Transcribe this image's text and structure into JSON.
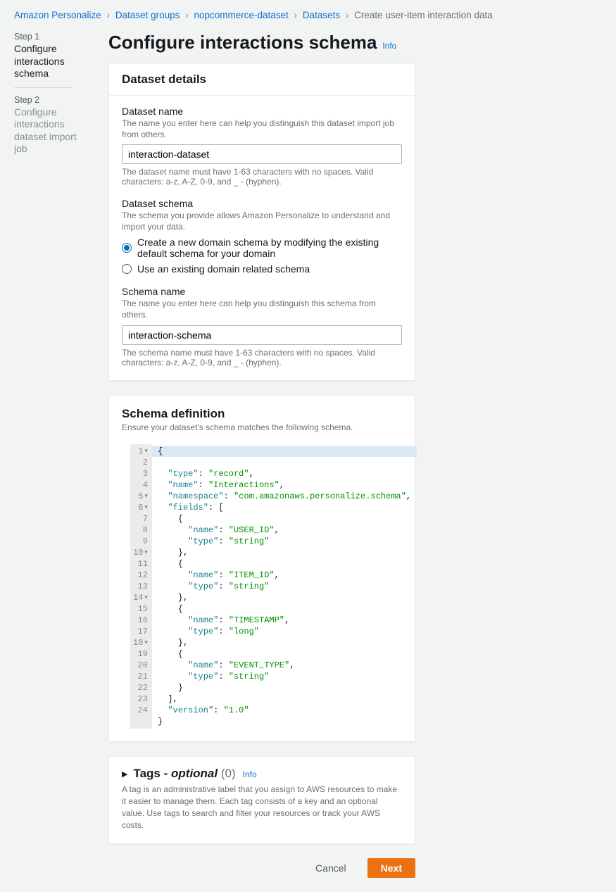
{
  "breadcrumb": {
    "items": [
      {
        "label": "Amazon Personalize",
        "link": true
      },
      {
        "label": "Dataset groups",
        "link": true
      },
      {
        "label": "nopcommerce-dataset",
        "link": true
      },
      {
        "label": "Datasets",
        "link": true
      },
      {
        "label": "Create user-item interaction data",
        "link": false
      }
    ]
  },
  "sidenav": {
    "step1_label": "Step 1",
    "step1_title": "Configure interactions schema",
    "step2_label": "Step 2",
    "step2_title": "Configure interactions dataset import job"
  },
  "header": {
    "title": "Configure interactions schema",
    "info": "Info"
  },
  "dataset_details": {
    "heading": "Dataset details",
    "name_label": "Dataset name",
    "name_desc": "The name you enter here can help you distinguish this dataset import job from others.",
    "name_value": "interaction-dataset",
    "name_constraint": "The dataset name must have 1-63 characters with no spaces. Valid characters: a-z, A-Z, 0-9, and _ - (hyphen).",
    "schema_label": "Dataset schema",
    "schema_desc": "The schema you provide allows Amazon Personalize to understand and import your data.",
    "radio_create": "Create a new domain schema by modifying the existing default schema for your domain",
    "radio_existing": "Use an existing domain related schema",
    "schema_name_label": "Schema name",
    "schema_name_desc": "The name you enter here can help you distinguish this schema from others.",
    "schema_name_value": "interaction-schema",
    "schema_name_constraint": "The schema name must have 1-63 characters with no spaces. Valid characters: a-z, A-Z, 0-9, and _ - (hyphen)."
  },
  "schema_definition": {
    "heading": "Schema definition",
    "desc": "Ensure your dataset's schema matches the following schema.",
    "schema": {
      "type": "record",
      "name": "Interactions",
      "namespace": "com.amazonaws.personalize.schema",
      "fields": [
        {
          "name": "USER_ID",
          "type": "string"
        },
        {
          "name": "ITEM_ID",
          "type": "string"
        },
        {
          "name": "TIMESTAMP",
          "type": "long"
        },
        {
          "name": "EVENT_TYPE",
          "type": "string"
        }
      ],
      "version": "1.0"
    }
  },
  "tags": {
    "heading": "Tags -",
    "optional": "optional",
    "count": "(0)",
    "info": "Info",
    "desc": "A tag is an administrative label that you assign to AWS resources to make it easier to manage them. Each tag consists of a key and an optional value. Use tags to search and filter your resources or track your AWS costs."
  },
  "actions": {
    "cancel": "Cancel",
    "next": "Next"
  }
}
